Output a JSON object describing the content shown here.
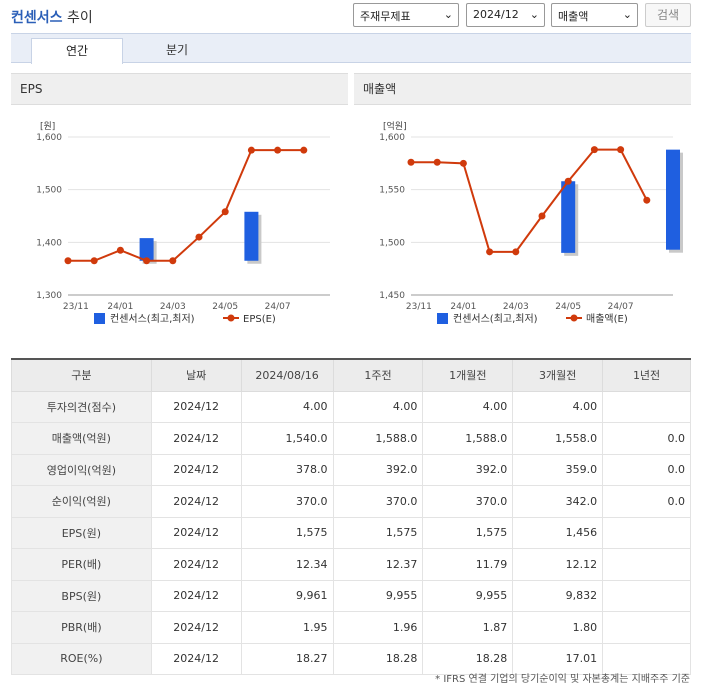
{
  "header": {
    "title_brand": "컨센서스",
    "title_suffix": " 추이",
    "select_basis": "주재무제표",
    "select_period": "2024/12",
    "select_metric": "매출액",
    "search_label": "검색"
  },
  "tabs": [
    {
      "label": "연간",
      "active": true
    },
    {
      "label": "분기",
      "active": false
    }
  ],
  "chart_data": [
    {
      "type": "line",
      "panel_title": "EPS",
      "unit_label": "[원]",
      "yticks": [
        "1,600",
        "1,500",
        "1,400",
        "1,300"
      ],
      "ylim": [
        1300,
        1600
      ],
      "xticks": [
        "23/11",
        "24/01",
        "24/03",
        "24/05",
        "24/07"
      ],
      "x_count": 11,
      "range_series": {
        "name": "컨센서스(최고,최저)",
        "color": "#1f5fe0",
        "bars": [
          {
            "index": 3,
            "low": 1365,
            "high": 1408
          },
          {
            "index": 7,
            "low": 1365,
            "high": 1458
          }
        ]
      },
      "line_series": {
        "name": "EPS(E)",
        "color": "#d03a0c",
        "values": [
          1365,
          1365,
          1385,
          1365,
          1365,
          1410,
          1458,
          1575,
          1575,
          1575,
          null
        ]
      }
    },
    {
      "type": "line",
      "panel_title": "매출액",
      "unit_label": "[억원]",
      "yticks": [
        "1,600",
        "1,550",
        "1,500",
        "1,450"
      ],
      "ylim": [
        1450,
        1600
      ],
      "xticks": [
        "23/11",
        "24/01",
        "24/03",
        "24/05",
        "24/07"
      ],
      "x_count": 11,
      "range_series": {
        "name": "컨센서스(최고,최저)",
        "color": "#1f5fe0",
        "bars": [
          {
            "index": 6,
            "low": 1490,
            "high": 1558
          },
          {
            "index": 10,
            "low": 1493,
            "high": 1588
          }
        ]
      },
      "line_series": {
        "name": "매출액(E)",
        "color": "#d03a0c",
        "values": [
          1576,
          1576,
          1575,
          1491,
          1491,
          1525,
          1558,
          1588,
          1588,
          1540,
          null
        ]
      }
    }
  ],
  "table": {
    "headers": [
      "구분",
      "날짜",
      "2024/08/16",
      "1주전",
      "1개월전",
      "3개월전",
      "1년전"
    ],
    "rows": [
      [
        "투자의견(점수)",
        "2024/12",
        "4.00",
        "4.00",
        "4.00",
        "4.00",
        ""
      ],
      [
        "매출액(억원)",
        "2024/12",
        "1,540.0",
        "1,588.0",
        "1,588.0",
        "1,558.0",
        "0.0"
      ],
      [
        "영업이익(억원)",
        "2024/12",
        "378.0",
        "392.0",
        "392.0",
        "359.0",
        "0.0"
      ],
      [
        "순이익(억원)",
        "2024/12",
        "370.0",
        "370.0",
        "370.0",
        "342.0",
        "0.0"
      ],
      [
        "EPS(원)",
        "2024/12",
        "1,575",
        "1,575",
        "1,575",
        "1,456",
        ""
      ],
      [
        "PER(배)",
        "2024/12",
        "12.34",
        "12.37",
        "11.79",
        "12.12",
        ""
      ],
      [
        "BPS(원)",
        "2024/12",
        "9,961",
        "9,955",
        "9,955",
        "9,832",
        ""
      ],
      [
        "PBR(배)",
        "2024/12",
        "1.95",
        "1.96",
        "1.87",
        "1.80",
        ""
      ],
      [
        "ROE(%)",
        "2024/12",
        "18.27",
        "18.28",
        "18.28",
        "17.01",
        ""
      ]
    ]
  },
  "footnote": "* IFRS 연결 기업의 당기순이익 및 자본총계는 지배주주 기준"
}
